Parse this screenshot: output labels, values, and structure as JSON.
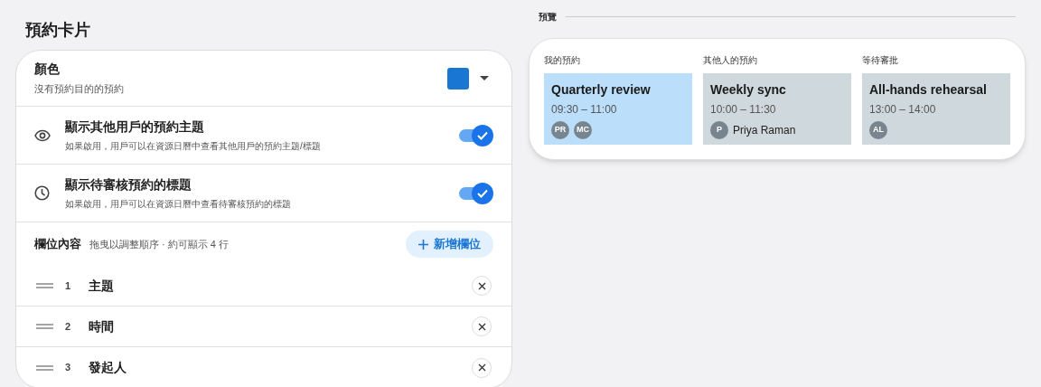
{
  "title": "預約卡片",
  "color_setting": {
    "label": "顏色",
    "description": "沒有預約目的的預約",
    "color": "#1976d2"
  },
  "toggles": [
    {
      "kind": "visibility",
      "label": "顯示其他用戶的預約主題",
      "description": "如果啟用，用戶可以在資源日曆中查看其他用戶的預約主題/標題",
      "on": true
    },
    {
      "kind": "pending",
      "label": "顯示待審核預約的標題",
      "description": "如果啟用，用戶可以在資源日曆中查看待審核預約的標題",
      "on": true
    }
  ],
  "fields_section": {
    "label": "欄位內容",
    "hint": "拖曳以調整順序 · 約可顯示 4 行",
    "add_button": "新增欄位"
  },
  "fields": [
    {
      "number": "1",
      "label": "主題"
    },
    {
      "number": "2",
      "label": "時間"
    },
    {
      "number": "3",
      "label": "發起人"
    }
  ],
  "preview": {
    "label": "預覽",
    "columns": [
      {
        "heading": "我的預約",
        "card": {
          "title": "Quarterly review",
          "time": "09:30 – 11:00",
          "color": "#bbdefb",
          "attendees": [
            {
              "initials": "PR"
            },
            {
              "initials": "MC"
            }
          ]
        }
      },
      {
        "heading": "其他人的預約",
        "card": {
          "title": "Weekly sync",
          "time": "10:00 – 11:30",
          "color": "#cfd8dc",
          "attendees": [
            {
              "initials": "P",
              "name": "Priya Raman"
            }
          ]
        }
      },
      {
        "heading": "等待審批",
        "card": {
          "title": "All-hands rehearsal",
          "time": "13:00 – 14:00",
          "color": "#cfd8dc",
          "attendees": [
            {
              "initials": "AL"
            }
          ]
        }
      }
    ]
  }
}
